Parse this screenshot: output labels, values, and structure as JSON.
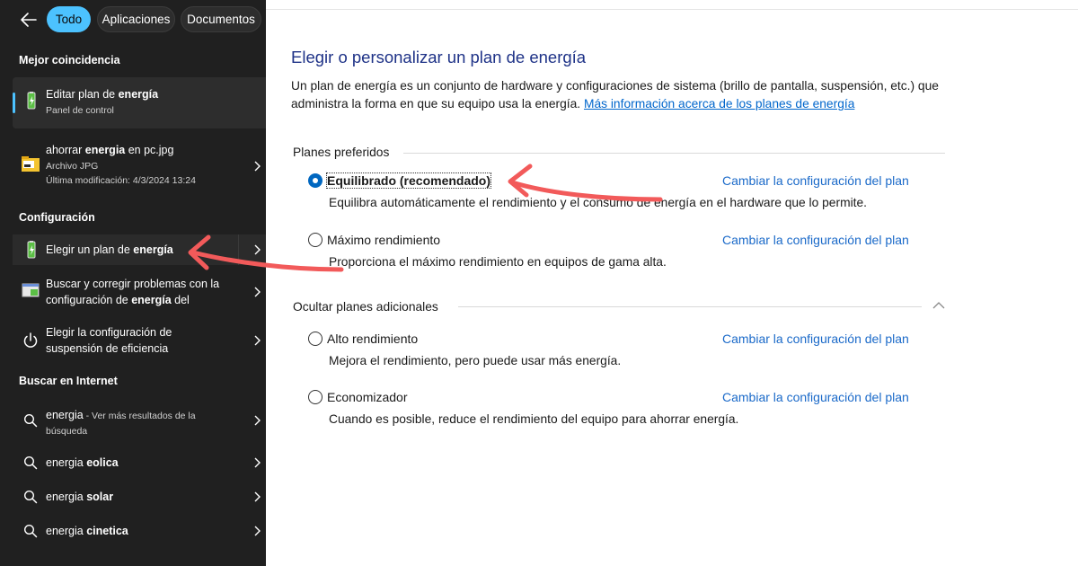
{
  "search": {
    "tabs": [
      {
        "label": "Todo"
      },
      {
        "label": "Aplicaciones"
      },
      {
        "label": "Documentos"
      }
    ],
    "best_match": {
      "heading": "Mejor coincidencia",
      "title_pre": "Editar plan de ",
      "title_bold": "energía",
      "subtitle": "Panel de control",
      "icon": "battery-icon"
    },
    "file_result": {
      "title_pre": "ahorrar ",
      "title_bold": "energia",
      "title_post": " en pc.jpg",
      "type": "Archivo JPG",
      "modified": "Última modificación: 4/3/2024 13:24",
      "icon": "image-file-icon"
    },
    "settings": {
      "heading": "Configuración",
      "items": [
        {
          "line1_pre": "Elegir un plan de ",
          "line1_bold": "energía",
          "icon": "battery-icon"
        },
        {
          "line1": "Buscar y corregir problemas con la",
          "line2_pre": "configuración de ",
          "line2_bold": "energía",
          "line2_post": " del",
          "icon": "troubleshoot-icon"
        },
        {
          "line1": "Elegir la configuración de",
          "line2": "suspensión de eficiencia",
          "icon": "power-icon"
        }
      ]
    },
    "web": {
      "heading": "Buscar en Internet",
      "first": {
        "query": "energia",
        "hint_line1": " - Ver más resultados de la",
        "hint_line2": "búsqueda"
      },
      "suggestions": [
        {
          "pre": "energia ",
          "bold": "eolica"
        },
        {
          "pre": "energia ",
          "bold": "solar"
        },
        {
          "pre": "energia ",
          "bold": "cinetica"
        }
      ]
    }
  },
  "control_panel": {
    "title": "Elegir o personalizar un plan de energía",
    "description": "Un plan de energía es un conjunto de hardware y configuraciones de sistema (brillo de pantalla, suspensión, etc.) que administra la forma en que su equipo usa la energía. ",
    "more_info_link": "Más información acerca de los planes de energía",
    "preferred_heading": "Planes preferidos",
    "hidden_heading": "Ocultar planes adicionales",
    "change_link": "Cambiar la configuración del plan",
    "plans": [
      {
        "name": "Equilibrado (recomendado)",
        "desc": "Equilibra automáticamente el rendimiento y el consumo de energía en el hardware que lo permite.",
        "selected": true
      },
      {
        "name": "Máximo rendimiento",
        "desc": "Proporciona el máximo rendimiento en equipos de gama alta.",
        "selected": false
      },
      {
        "name": "Alto rendimiento",
        "desc": "Mejora el rendimiento, pero puede usar más energía.",
        "selected": false
      },
      {
        "name": "Economizador",
        "desc": "Cuando es posible, reduce el rendimiento del equipo para ahorrar energía.",
        "selected": false
      }
    ]
  },
  "colors": {
    "panel_bg": "#202020",
    "accent": "#4cc2ff",
    "link": "#1b6ac9",
    "title": "#1e3287",
    "annotation_arrow": "#f25a5a"
  }
}
